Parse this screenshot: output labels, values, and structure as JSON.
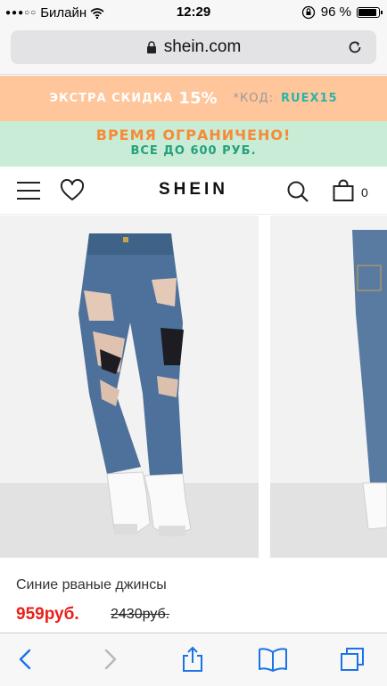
{
  "status_bar": {
    "signal": "●●●○○",
    "carrier": "Билайн",
    "time": "12:29",
    "battery": "96 %",
    "battery_level": 0.96
  },
  "browser": {
    "url": "shein.com"
  },
  "promo_discount": {
    "label": "ЭКСТРА СКИДКА",
    "percent": "15%",
    "code_label": "*КОД:",
    "code": "RUEX15"
  },
  "promo_limited": {
    "line1": "ВРЕМЯ ОГРАНИЧЕНО!",
    "line2": "ВСЕ ДО 600 РУБ."
  },
  "header": {
    "logo": "SHEIN",
    "cart_count": "0"
  },
  "product": {
    "name": "Синие рваные джинсы",
    "price": "959руб.",
    "old_price": "2430руб."
  },
  "colors": {
    "promo_orange": "#ffc59b",
    "promo_green": "#c8ecd6",
    "price_red": "#e8201a",
    "denim": "#4a6f96"
  }
}
